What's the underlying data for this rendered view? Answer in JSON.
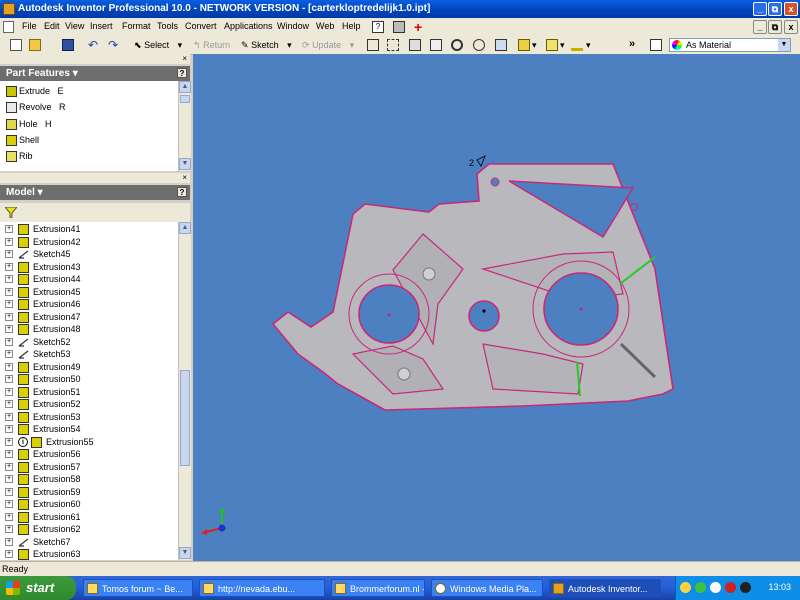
{
  "window": {
    "title": "Autodesk Inventor Professional 10.0 - NETWORK VERSION - [carterkloptredelijk1.0.ipt]"
  },
  "window_buttons": [
    "_",
    "⧉",
    "x"
  ],
  "menu": {
    "items": [
      "File",
      "Edit",
      "View",
      "Insert",
      "Format",
      "Tools",
      "Convert",
      "Applications",
      "Window",
      "Web",
      "Help"
    ]
  },
  "doc_buttons": [
    "_",
    "⧉",
    "x"
  ],
  "toolbar": {
    "select_label": "Select",
    "return_label": "Return",
    "sketch_label": "Sketch",
    "update_label": "Update",
    "material_value": "As Material"
  },
  "part_features": {
    "title": "Part Features ▾",
    "help": "?",
    "items": [
      {
        "label": "Extrude",
        "key": "E"
      },
      {
        "label": "Revolve",
        "key": "R"
      },
      {
        "label": "Hole",
        "key": "H"
      },
      {
        "label": "Shell",
        "key": ""
      },
      {
        "label": "Rib",
        "key": ""
      }
    ]
  },
  "model": {
    "title": "Model ▾",
    "help": "?",
    "tree": [
      {
        "label": "Extrusion41",
        "type": "extrusion"
      },
      {
        "label": "Extrusion42",
        "type": "extrusion"
      },
      {
        "label": "Sketch45",
        "type": "sketch"
      },
      {
        "label": "Extrusion43",
        "type": "extrusion"
      },
      {
        "label": "Extrusion44",
        "type": "extrusion"
      },
      {
        "label": "Extrusion45",
        "type": "extrusion"
      },
      {
        "label": "Extrusion46",
        "type": "extrusion"
      },
      {
        "label": "Extrusion47",
        "type": "extrusion"
      },
      {
        "label": "Extrusion48",
        "type": "extrusion"
      },
      {
        "label": "Sketch52",
        "type": "sketch"
      },
      {
        "label": "Sketch53",
        "type": "sketch"
      },
      {
        "label": "Extrusion49",
        "type": "extrusion"
      },
      {
        "label": "Extrusion50",
        "type": "extrusion"
      },
      {
        "label": "Extrusion51",
        "type": "extrusion"
      },
      {
        "label": "Extrusion52",
        "type": "extrusion"
      },
      {
        "label": "Extrusion53",
        "type": "extrusion"
      },
      {
        "label": "Extrusion54",
        "type": "extrusion"
      },
      {
        "label": "Extrusion55",
        "type": "warning"
      },
      {
        "label": "Extrusion56",
        "type": "extrusion"
      },
      {
        "label": "Extrusion57",
        "type": "extrusion"
      },
      {
        "label": "Extrusion58",
        "type": "extrusion"
      },
      {
        "label": "Extrusion59",
        "type": "extrusion"
      },
      {
        "label": "Extrusion60",
        "type": "extrusion"
      },
      {
        "label": "Extrusion61",
        "type": "extrusion"
      },
      {
        "label": "Extrusion62",
        "type": "extrusion"
      },
      {
        "label": "Sketch67",
        "type": "sketch"
      },
      {
        "label": "Extrusion63",
        "type": "extrusion"
      }
    ]
  },
  "viewport": {
    "background": "#4d80c0",
    "part_fill": "#b9b9bd",
    "edge_color": "#c8287a",
    "marker_label": "2"
  },
  "status": {
    "text": "Ready"
  },
  "taskbar": {
    "start_label": "start",
    "tasks": [
      {
        "label": "Tomos forum ~ Be...",
        "active": false
      },
      {
        "label": "http://nevada.ebu...",
        "active": false
      },
      {
        "label": "Brommerforum.nl - ...",
        "active": false
      },
      {
        "label": "Windows Media Pla...",
        "active": false
      },
      {
        "label": "Autodesk Inventor...",
        "active": true
      }
    ],
    "clock": "13:03"
  }
}
